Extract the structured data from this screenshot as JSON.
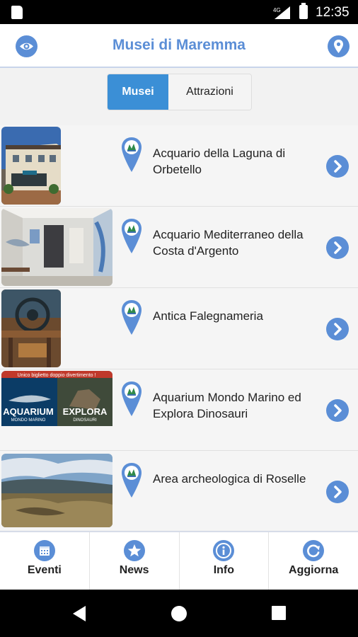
{
  "status_bar": {
    "network": "4G",
    "time": "12:35"
  },
  "header": {
    "title": "Musei di Maremma",
    "left_icon": "eye-icon",
    "right_icon": "location-pin-icon"
  },
  "segment": {
    "active_label": "Musei",
    "inactive_label": "Attrazioni"
  },
  "items": [
    {
      "name": "Acquario della Laguna di Orbetello"
    },
    {
      "name": "Acquario Mediterraneo della Costa d'Argento"
    },
    {
      "name": "Antica Falegnameria"
    },
    {
      "name": "Aquarium Mondo Marino ed Explora Dinosauri",
      "thumb_banner": "Unico biglietto doppio divertimento !",
      "thumb_left_title": "AQUARIUM",
      "thumb_left_sub": "MONDO MARINO",
      "thumb_right_title": "EXPLORA",
      "thumb_right_sub": "DINOSAURI"
    },
    {
      "name": "Area archeologica di Roselle"
    }
  ],
  "tabbar": {
    "tabs": [
      {
        "label": "Eventi",
        "icon": "calendar-icon"
      },
      {
        "label": "News",
        "icon": "star-icon"
      },
      {
        "label": "Info",
        "icon": "info-icon"
      },
      {
        "label": "Aggiorna",
        "icon": "refresh-icon"
      }
    ]
  },
  "colors": {
    "accent": "#5b8ed6",
    "segment_active": "#3b8fd6",
    "status_bar": "#000000"
  }
}
